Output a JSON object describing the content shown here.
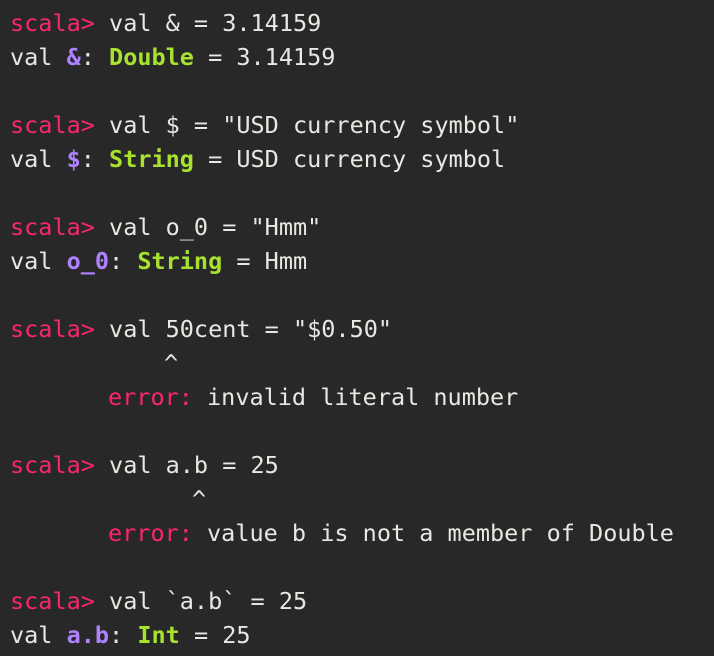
{
  "terminal": {
    "prompt": "scala>",
    "error_label": "error:",
    "blocks": [
      {
        "input": "val & = 3.14159",
        "result": {
          "prefix": "val ",
          "name": "&",
          "sep": ": ",
          "type": "Double",
          "rest": " = 3.14159"
        }
      },
      {
        "input": "val $ = \"USD currency symbol\"",
        "result": {
          "prefix": "val ",
          "name": "$",
          "sep": ": ",
          "type": "String",
          "rest": " = USD currency symbol"
        }
      },
      {
        "input": "val o_0 = \"Hmm\"",
        "result": {
          "prefix": "val ",
          "name": "o_0",
          "sep": ": ",
          "type": "String",
          "rest": " = Hmm"
        }
      },
      {
        "input": "val 50cent = \"$0.50\"",
        "caret": "^",
        "error_message": " invalid literal number"
      },
      {
        "input": "val a.b = 25",
        "caret": "^",
        "error_message": " value b is not a member of Double"
      },
      {
        "input": "val `a.b` = 25",
        "result": {
          "prefix": "val ",
          "name": "a.b",
          "sep": ": ",
          "type": "Int",
          "rest": " = 25"
        }
      }
    ]
  }
}
